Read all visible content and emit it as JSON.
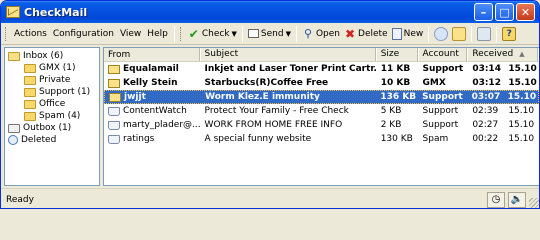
{
  "window": {
    "title": "CheckMail"
  },
  "menu": [
    "Actions",
    "Configuration",
    "View",
    "Help"
  ],
  "toolbar": {
    "check": "Check",
    "send": "Send",
    "open": "Open",
    "delete": "Delete",
    "new": "New"
  },
  "folders": [
    {
      "label": "Inbox (6)",
      "icon": "inbox-folder-icon",
      "child": false
    },
    {
      "label": "GMX (1)",
      "icon": "folder-icon",
      "child": true
    },
    {
      "label": "Private",
      "icon": "folder-icon",
      "child": true
    },
    {
      "label": "Support (1)",
      "icon": "folder-icon",
      "child": true
    },
    {
      "label": "Office",
      "icon": "folder-icon",
      "child": true
    },
    {
      "label": "Spam (4)",
      "icon": "folder-icon",
      "child": true
    },
    {
      "label": "Outbox (1)",
      "icon": "outbox-icon",
      "child": false
    },
    {
      "label": "Deleted",
      "icon": "deleted-icon",
      "child": false
    }
  ],
  "columns": {
    "from": "From",
    "subject": "Subject",
    "size": "Size",
    "account": "Account",
    "received": "Received"
  },
  "messages": [
    {
      "from": "Equalamail",
      "subject": "Inkjet and Laser Toner Print Cartr...",
      "size": "11 KB",
      "account": "Support",
      "time": "03:14",
      "date": "15.10",
      "unread": true,
      "selected": false
    },
    {
      "from": "Kelly Stein",
      "subject": "Starbucks(R)Coffee Free",
      "size": "10 KB",
      "account": "GMX",
      "time": "03:12",
      "date": "15.10",
      "unread": true,
      "selected": false
    },
    {
      "from": "jwjjt",
      "subject": "Worm Klez.E immunity",
      "size": "136 KB",
      "account": "Support",
      "time": "03:07",
      "date": "15.10",
      "unread": true,
      "selected": true
    },
    {
      "from": "ContentWatch",
      "subject": "Protect Your Family - Free Check",
      "size": "5 KB",
      "account": "Support",
      "time": "02:39",
      "date": "15.10",
      "unread": false,
      "selected": false
    },
    {
      "from": "marty_plader@...",
      "subject": "WORK FROM HOME FREE INFO",
      "size": "2 KB",
      "account": "Support",
      "time": "02:27",
      "date": "15.10",
      "unread": false,
      "selected": false
    },
    {
      "from": "ratings",
      "subject": "A special  funny website",
      "size": "130 KB",
      "account": "Spam",
      "time": "00:22",
      "date": "15.10",
      "unread": false,
      "selected": false
    }
  ],
  "status": {
    "text": "Ready"
  },
  "colors": {
    "titlebar": "#0551e0",
    "selection": "#316ac5",
    "check_icon": "#1a9a1a",
    "delete_icon": "#d42020"
  }
}
